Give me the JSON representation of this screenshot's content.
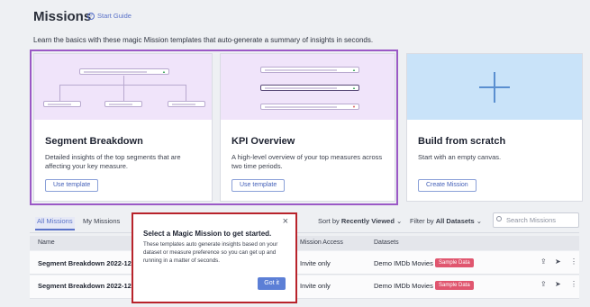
{
  "page": {
    "title": "Missions",
    "start_guide": "Start Guide",
    "intro": "Learn the basics with these magic Mission templates that auto-generate a summary of insights in seconds."
  },
  "templates": [
    {
      "title": "Segment Breakdown",
      "description": "Detailed insights of the top segments that are affecting your key measure.",
      "button": "Use template"
    },
    {
      "title": "KPI Overview",
      "description": "A high-level overview of your top measures across two time periods.",
      "button": "Use template"
    },
    {
      "title": "Build from scratch",
      "description": "Start with an empty canvas.",
      "button": "Create Mission"
    }
  ],
  "tabs": [
    "All Missions",
    "My Missions"
  ],
  "sort": {
    "label": "Sort by",
    "value": "Recently Viewed"
  },
  "filter": {
    "label": "Filter by",
    "value": "All Datasets"
  },
  "search": {
    "placeholder": "Search Missions"
  },
  "table": {
    "headers": [
      "Name",
      "Mission Access",
      "Datasets"
    ],
    "rows": [
      {
        "name": "Segment Breakdown 2022-12",
        "access": "Invite only",
        "dataset": "Demo IMDb Movies",
        "badge": "Sample Data"
      },
      {
        "name": "Segment Breakdown 2022-12",
        "access": "Invite only",
        "dataset": "Demo IMDb Movies",
        "badge": "Sample Data"
      }
    ]
  },
  "popup": {
    "title": "Select a Magic Mission to get started.",
    "body": "These templates auto generate insights based on your dataset or measure preference so you can get up and running in a matter of seconds.",
    "button": "Got it",
    "close": "×"
  },
  "colors": {
    "accent": "#5a72c8",
    "highlight": "#9b59c6",
    "popup_border": "#b8232b",
    "badge": "#e0566f"
  }
}
